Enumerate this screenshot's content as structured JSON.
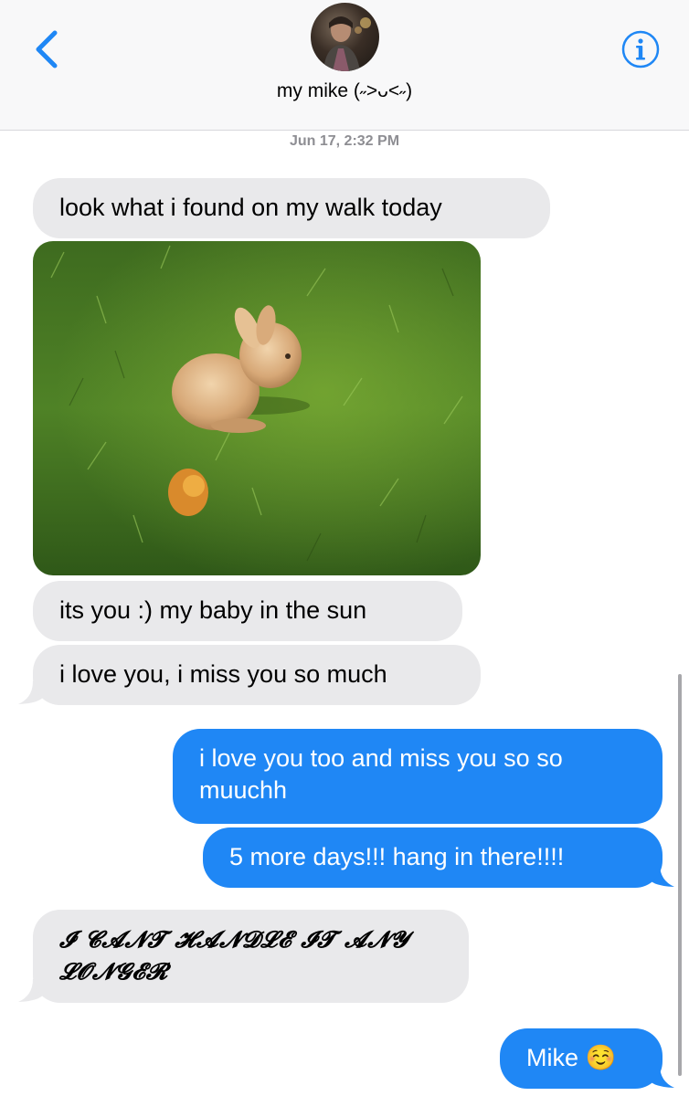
{
  "header": {
    "back_icon": "chevron-left-icon",
    "contact_name": "my mike (˶>ᴗ<˶)",
    "info_icon": "info-icon",
    "accent_color": "#1f87f5"
  },
  "timestamp": "Jun 17, 2:32 PM",
  "messages": [
    {
      "direction": "incoming",
      "type": "text",
      "text": "look what i found on my walk today"
    },
    {
      "direction": "incoming",
      "type": "image",
      "alt": "bunny in the grass"
    },
    {
      "direction": "incoming",
      "type": "text",
      "text": "its you :) my baby in the sun"
    },
    {
      "direction": "incoming",
      "type": "text",
      "text": "i love you, i miss you so much"
    },
    {
      "direction": "outgoing",
      "type": "text",
      "text": "i love you too and miss you so so muuchh"
    },
    {
      "direction": "outgoing",
      "type": "text",
      "text": "5 more days!!! hang in there!!!!"
    },
    {
      "direction": "incoming",
      "type": "text",
      "text": "𝓘 𝓒𝓐𝓝𝓣 𝓗𝓐𝓝𝓓𝓛𝓔 𝓘𝓣 𝓐𝓝𝓨 𝓛𝓞𝓝𝓖𝓔𝓡"
    },
    {
      "direction": "outgoing",
      "type": "text",
      "text": "Mike ☺️"
    }
  ],
  "colors": {
    "incoming_bubble": "#e9e9eb",
    "outgoing_bubble": "#1f87f5"
  }
}
